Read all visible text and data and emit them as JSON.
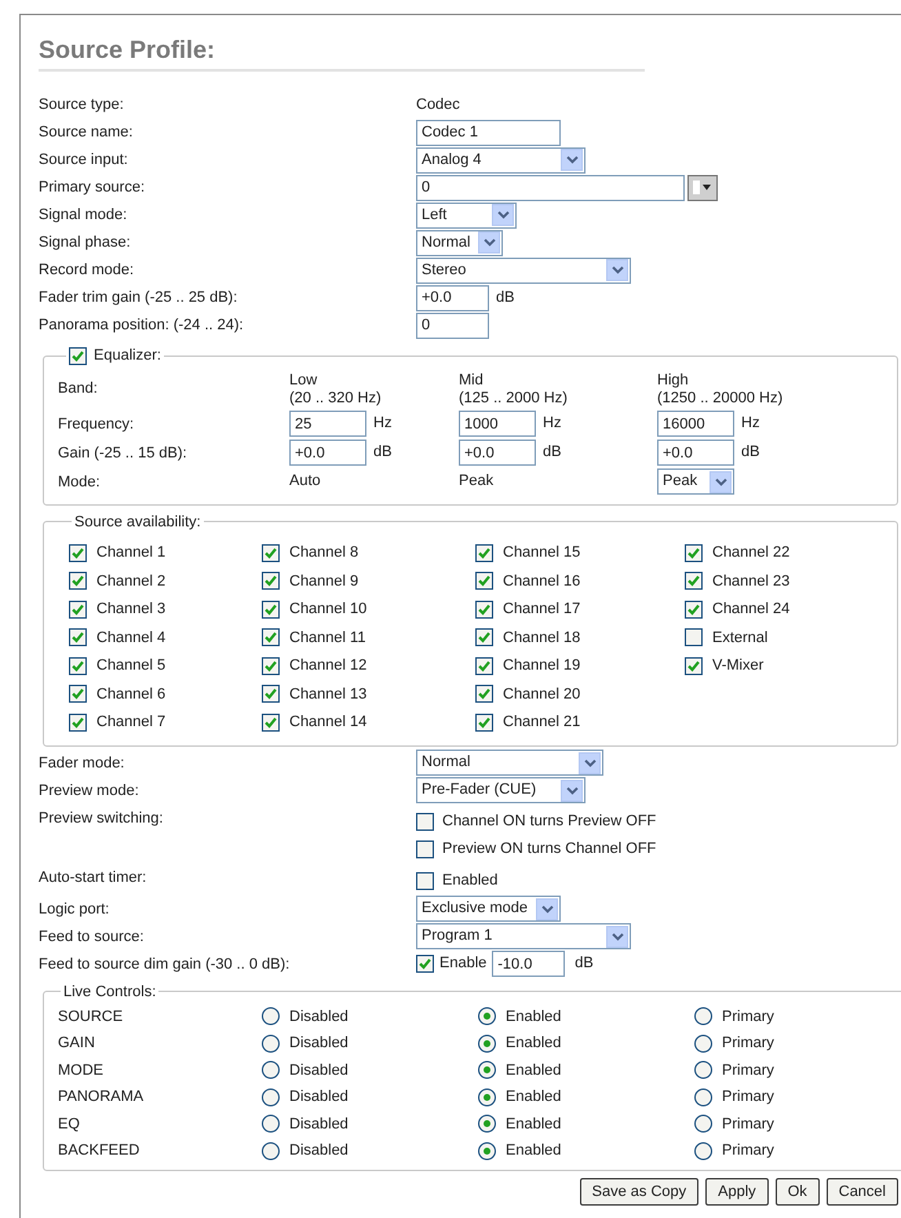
{
  "title": "Source Profile:",
  "fields": [
    {
      "kind": "text",
      "label": "Source type:",
      "value": "Codec"
    },
    {
      "kind": "input",
      "label": "Source name:",
      "value": "Codec 1"
    },
    {
      "kind": "select",
      "label": "Source input:",
      "value": "Analog 4"
    },
    {
      "kind": "combo",
      "label": "Primary source:",
      "value": "0"
    },
    {
      "kind": "select",
      "label": "Signal mode:",
      "value": "Left"
    },
    {
      "kind": "select",
      "label": "Signal phase:",
      "value": "Normal"
    },
    {
      "kind": "select",
      "label": "Record mode:",
      "value": "Stereo"
    },
    {
      "kind": "input",
      "label": "Fader trim gain (-25 .. 25 dB):",
      "value": "+0.0",
      "unit": "dB"
    },
    {
      "kind": "input",
      "label": "Panorama position: (-24 .. 24):",
      "value": "0"
    }
  ],
  "equalizer": {
    "label": "Equalizer:",
    "enabled": true,
    "band_label": "Band:",
    "frequency_label": "Frequency:",
    "gain_label": "Gain (-25 .. 15 dB):",
    "mode_label": "Mode:",
    "bands": [
      {
        "name": "Low",
        "range": "(20 .. 320 Hz)",
        "frequency": "25",
        "frequency_unit": "Hz",
        "gain": "+0.0",
        "gain_unit": "dB",
        "mode": {
          "kind": "text",
          "value": "Auto"
        }
      },
      {
        "name": "Mid",
        "range": "(125 .. 2000 Hz)",
        "frequency": "1000",
        "frequency_unit": "Hz",
        "gain": "+0.0",
        "gain_unit": "dB",
        "mode": {
          "kind": "text",
          "value": "Peak"
        }
      },
      {
        "name": "High",
        "range": "(1250 .. 20000 Hz)",
        "frequency": "16000",
        "frequency_unit": "Hz",
        "gain": "+0.0",
        "gain_unit": "dB",
        "mode": {
          "kind": "select",
          "value": "Peak"
        }
      }
    ]
  },
  "availability": {
    "label": "Source availability:",
    "items": [
      {
        "label": "Channel 1",
        "checked": true
      },
      {
        "label": "Channel 2",
        "checked": true
      },
      {
        "label": "Channel 3",
        "checked": true
      },
      {
        "label": "Channel 4",
        "checked": true
      },
      {
        "label": "Channel 5",
        "checked": true
      },
      {
        "label": "Channel 6",
        "checked": true
      },
      {
        "label": "Channel 7",
        "checked": true
      },
      {
        "label": "Channel 8",
        "checked": true
      },
      {
        "label": "Channel 9",
        "checked": true
      },
      {
        "label": "Channel 10",
        "checked": true
      },
      {
        "label": "Channel 11",
        "checked": true
      },
      {
        "label": "Channel 12",
        "checked": true
      },
      {
        "label": "Channel 13",
        "checked": true
      },
      {
        "label": "Channel 14",
        "checked": true
      },
      {
        "label": "Channel 15",
        "checked": true
      },
      {
        "label": "Channel 16",
        "checked": true
      },
      {
        "label": "Channel 17",
        "checked": true
      },
      {
        "label": "Channel 18",
        "checked": true
      },
      {
        "label": "Channel 19",
        "checked": true
      },
      {
        "label": "Channel 20",
        "checked": true
      },
      {
        "label": "Channel 21",
        "checked": true
      },
      {
        "label": "Channel 22",
        "checked": true
      },
      {
        "label": "Channel 23",
        "checked": true
      },
      {
        "label": "Channel 24",
        "checked": true
      },
      {
        "label": "External",
        "checked": false
      },
      {
        "label": "V-Mixer",
        "checked": true
      }
    ]
  },
  "more_fields": [
    {
      "kind": "select",
      "label": "Fader mode:",
      "value": "Normal"
    },
    {
      "kind": "select",
      "label": "Preview mode:",
      "value": "Pre-Fader (CUE)"
    },
    {
      "kind": "checks",
      "label": "Preview switching:",
      "options": [
        {
          "label": "Channel ON turns Preview OFF",
          "checked": false
        },
        {
          "label": "Preview ON turns Channel OFF",
          "checked": false
        }
      ]
    },
    {
      "kind": "checks",
      "label": "Auto-start timer:",
      "options": [
        {
          "label": "Enabled",
          "checked": false
        }
      ]
    },
    {
      "kind": "select",
      "label": "Logic port:",
      "value": "Exclusive mode"
    },
    {
      "kind": "select",
      "label": "Feed to source:",
      "value": "Program 1"
    },
    {
      "kind": "check_input",
      "label": "Feed to source dim gain (-30 .. 0 dB):",
      "check_label": "Enable",
      "checked": true,
      "value": "-10.0",
      "unit": "dB"
    }
  ],
  "live_controls": {
    "label": "Live Controls:",
    "rows": [
      {
        "name": "SOURCE",
        "options": [
          {
            "label": "Disabled",
            "selected": false
          },
          {
            "label": "Enabled",
            "selected": true
          },
          {
            "label": "Primary",
            "selected": false
          }
        ]
      },
      {
        "name": "GAIN",
        "options": [
          {
            "label": "Disabled",
            "selected": false
          },
          {
            "label": "Enabled",
            "selected": true
          },
          {
            "label": "Primary",
            "selected": false
          }
        ]
      },
      {
        "name": "MODE",
        "options": [
          {
            "label": "Disabled",
            "selected": false
          },
          {
            "label": "Enabled",
            "selected": true
          },
          {
            "label": "Primary",
            "selected": false
          }
        ]
      },
      {
        "name": "PANORAMA",
        "options": [
          {
            "label": "Disabled",
            "selected": false
          },
          {
            "label": "Enabled",
            "selected": true
          },
          {
            "label": "Primary",
            "selected": false
          }
        ]
      },
      {
        "name": "EQ",
        "options": [
          {
            "label": "Disabled",
            "selected": false
          },
          {
            "label": "Enabled",
            "selected": true
          },
          {
            "label": "Primary",
            "selected": false
          }
        ]
      },
      {
        "name": "BACKFEED",
        "options": [
          {
            "label": "Disabled",
            "selected": false
          },
          {
            "label": "Enabled",
            "selected": true
          },
          {
            "label": "Primary",
            "selected": false
          }
        ]
      }
    ]
  },
  "buttons": [
    "Save as Copy",
    "Apply",
    "Ok",
    "Cancel"
  ]
}
